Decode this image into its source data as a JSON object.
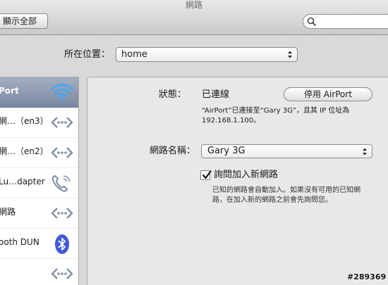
{
  "window": {
    "title": "網路"
  },
  "toolbar": {
    "show_all_label": "顯示全部",
    "search_placeholder": ""
  },
  "location": {
    "label": "所在位置：",
    "value": "home"
  },
  "sidebar": {
    "items": [
      {
        "label": "Port",
        "icon": "wifi-icon",
        "selected": true
      },
      {
        "label": "網…（en3）",
        "icon": "ethernet-icon",
        "selected": false
      },
      {
        "label": "網…（en2）",
        "icon": "ethernet-icon",
        "selected": false
      },
      {
        "label": "Lu…dapter",
        "icon": "phone-modem-icon",
        "selected": false
      },
      {
        "label": "網路",
        "icon": "ethernet-icon",
        "selected": false
      },
      {
        "label": "ooth DUN",
        "icon": "bluetooth-icon",
        "selected": false
      },
      {
        "label": "",
        "icon": "ethernet-icon",
        "selected": false
      }
    ]
  },
  "status": {
    "label": "狀態：",
    "value": "已連線",
    "button_label": "停用 AirPort",
    "description_line1": "“AirPort”已連接至“Gary 3G”，且其 IP 位址為",
    "description_line2": "192.168.1.100。"
  },
  "network": {
    "label": "網路名稱：",
    "value": "Gary 3G",
    "ask_join_label": "詢問加入新網路",
    "ask_join_checked": true,
    "ask_join_desc_line1": "已知的網路會自動加入。如果沒有可用的已知網",
    "ask_join_desc_line2": "路，在加入新的網路之前會先詢問您。"
  },
  "watermark": "#289369",
  "colors": {
    "selection": "#8693a9",
    "panel": "#e8e8e8",
    "toolbar": "#d4d4d4"
  }
}
